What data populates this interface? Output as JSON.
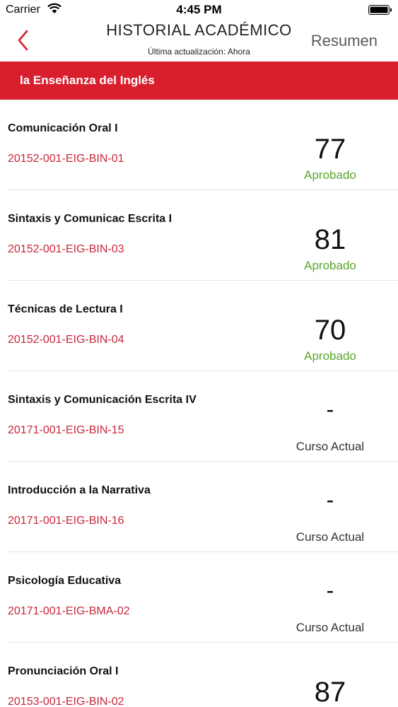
{
  "status_bar": {
    "carrier": "Carrier",
    "time": "4:45 PM"
  },
  "nav": {
    "back_icon": "chevron-left-icon",
    "title": "HISTORIAL ACADÉMICO",
    "subtitle": "Última actualización: Ahora",
    "right_label": "Resumen"
  },
  "section": {
    "title": "la Enseñanza del Inglés"
  },
  "colors": {
    "accent_red": "#d91e2e",
    "code_red": "#c8273a",
    "passed_green": "#5aa52c"
  },
  "courses": [
    {
      "name": "Comunicación Oral I",
      "code": "20152-001-EIG-BIN-01",
      "grade": "77",
      "status": "Aprobado"
    },
    {
      "name": "Sintaxis y Comunicac Escrita I",
      "code": "20152-001-EIG-BIN-03",
      "grade": "81",
      "status": "Aprobado"
    },
    {
      "name": "Técnicas de Lectura I",
      "code": "20152-001-EIG-BIN-04",
      "grade": "70",
      "status": "Aprobado"
    },
    {
      "name": "Sintaxis y Comunicación Escrita IV",
      "code": "20171-001-EIG-BIN-15",
      "grade": "-",
      "status": "Curso Actual"
    },
    {
      "name": "Introducción a la Narrativa",
      "code": "20171-001-EIG-BIN-16",
      "grade": "-",
      "status": "Curso Actual"
    },
    {
      "name": "Psicología Educativa",
      "code": "20171-001-EIG-BMA-02",
      "grade": "-",
      "status": "Curso Actual"
    },
    {
      "name": "Pronunciación Oral I",
      "code": "20153-001-EIG-BIN-02",
      "grade": "87",
      "status": ""
    }
  ]
}
